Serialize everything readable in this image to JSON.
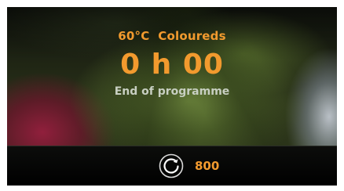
{
  "programme": {
    "title": "60°C  Coloureds"
  },
  "time_remaining": "0 h 00",
  "status": "End of programme",
  "bottom_bar": {
    "spin_icon": "spin-speed-icon",
    "spin_value": "800"
  },
  "colors": {
    "accent": "#f29a2e",
    "status_text": "#c8cfc2",
    "bar_background": "#000000"
  }
}
